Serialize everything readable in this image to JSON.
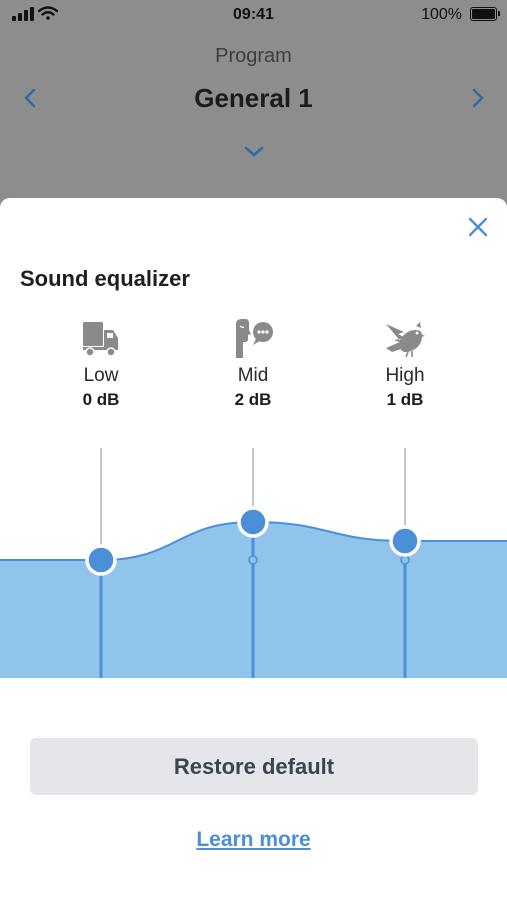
{
  "status_bar": {
    "time": "09:41",
    "battery_text": "100%"
  },
  "program": {
    "label": "Program",
    "name": "General 1",
    "prev_icon": "chevron-left-icon",
    "next_icon": "chevron-right-icon",
    "expand_icon": "chevron-down-icon"
  },
  "sheet": {
    "title": "Sound equalizer",
    "close_icon": "close-icon",
    "bands": [
      {
        "name": "Low",
        "value": "0 dB",
        "db": 0,
        "icon": "truck-icon"
      },
      {
        "name": "Mid",
        "value": "2 dB",
        "db": 2,
        "icon": "speaking-person-icon"
      },
      {
        "name": "High",
        "value": "1 dB",
        "db": 1,
        "icon": "bird-icon"
      }
    ],
    "restore_label": "Restore default",
    "learn_more_label": "Learn more"
  },
  "colors": {
    "accent": "#4a8fd8",
    "fill": "#90c4ea",
    "overlay": "#8d8d8d",
    "button_bg": "#e4e6e9"
  }
}
